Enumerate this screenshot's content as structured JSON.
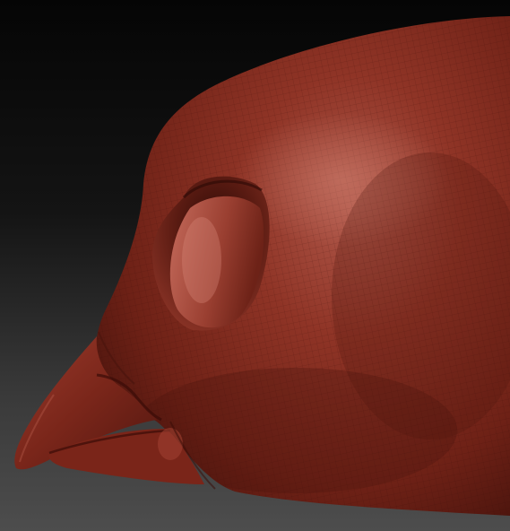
{
  "scene": {
    "subject": "sculpted-bird-head-clay-render",
    "background_color_top": "#050505",
    "background_color_bottom": "#4d4d4d",
    "clay_base_color": "#8a2f22",
    "clay_highlight_color": "#c46a5c",
    "clay_shadow_color": "#4a140d",
    "wireframe_visible": true
  }
}
